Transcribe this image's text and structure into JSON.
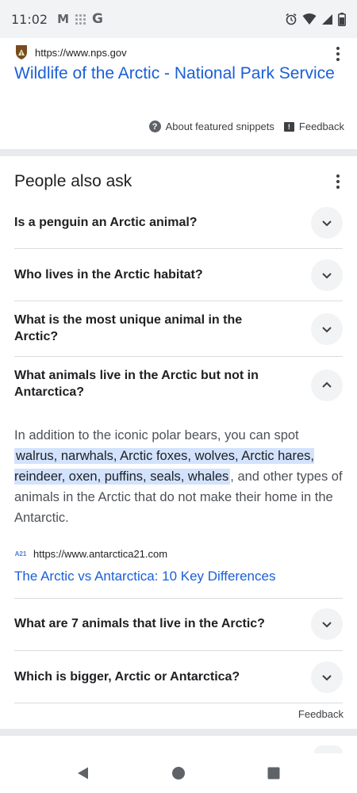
{
  "status_bar": {
    "time": "11:02",
    "icons_left": [
      "gmail-icon",
      "apps-grid-icon",
      "google-icon"
    ],
    "icons_right": [
      "alarm-icon",
      "wifi-icon",
      "signal-icon",
      "battery-icon"
    ]
  },
  "result": {
    "url": "https://www.nps.gov",
    "title": "Wildlife of the Arctic - National Park Service",
    "about_snippets_label": "About featured snippets",
    "feedback_label": "Feedback"
  },
  "paa": {
    "heading": "People also ask",
    "questions": [
      {
        "text": "Is a penguin an Arctic animal?",
        "expanded": false
      },
      {
        "text": "Who lives in the Arctic habitat?",
        "expanded": false
      },
      {
        "text": "What is the most unique animal in the Arctic?",
        "expanded": false
      },
      {
        "text": "What animals live in the Arctic but not in Antarctica?",
        "expanded": true
      },
      {
        "text": "What are 7 animals that live in the Arctic?",
        "expanded": false
      },
      {
        "text": "Which is bigger, Arctic or Antarctica?",
        "expanded": false
      }
    ],
    "answer": {
      "before": "In addition to the iconic polar bears, you can spot",
      "highlight": "walrus, narwhals, Arctic foxes, wolves, Arctic hares, reindeer, oxen, puffins, seals, whales",
      "after": ", and other types of animals in the Arctic that do not make their home in the Antarctic."
    },
    "source": {
      "icon_text": "A21",
      "url": "https://www.antarctica21.com",
      "title": "The Arctic vs Antarctica: 10 Key Differences"
    },
    "feedback_label": "Feedback"
  },
  "colors": {
    "link": "#1a5fd8",
    "highlight": "#d3e3fd",
    "band": "#e8eaed"
  }
}
